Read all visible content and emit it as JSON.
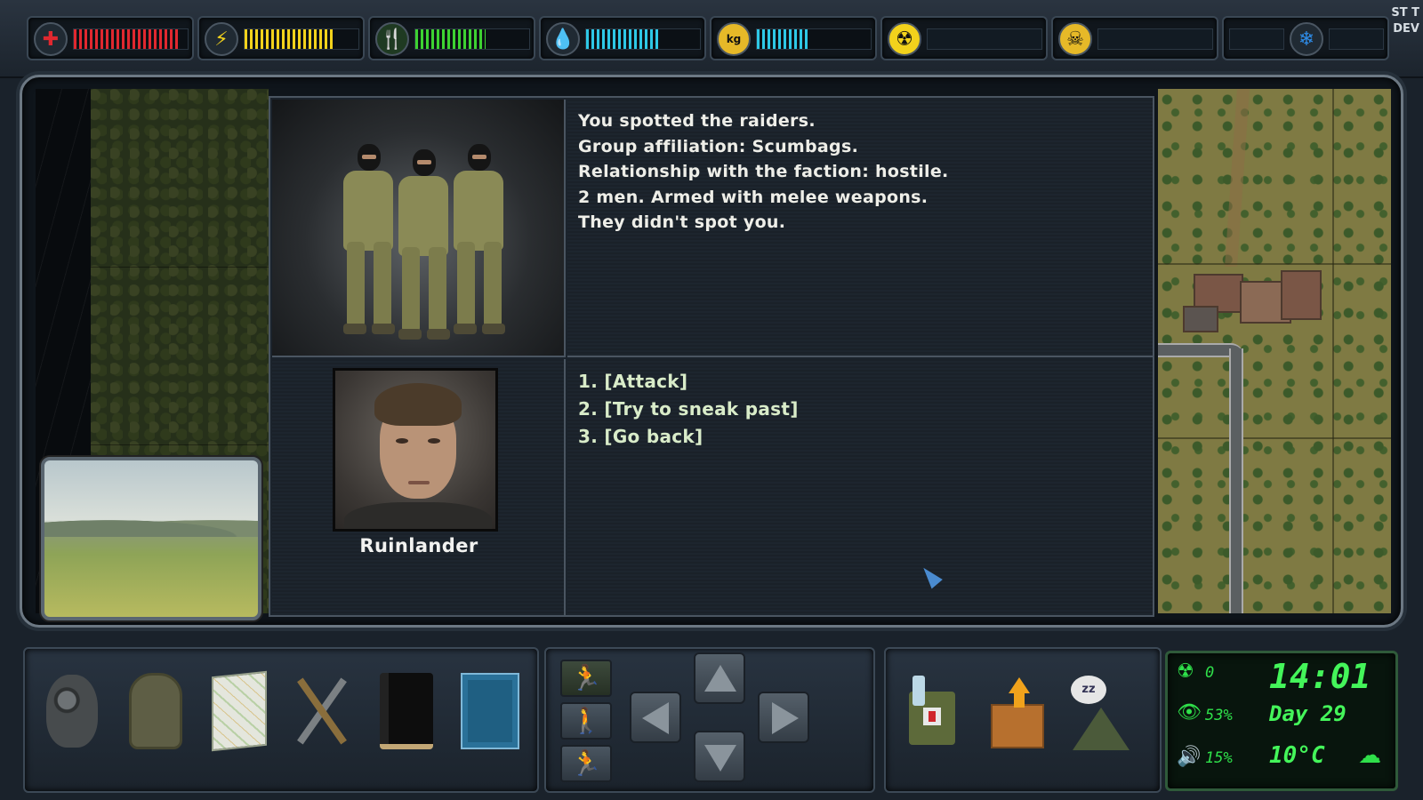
{
  "status_bars": {
    "health": {
      "icon": "health-cross-icon",
      "level": 0.92,
      "color": "#e0282f"
    },
    "energy": {
      "icon": "energy-bolt-icon",
      "level": 0.78,
      "color": "#f2d21c"
    },
    "food": {
      "icon": "food-fork-knife-icon",
      "level": 0.62,
      "color": "#3ed232"
    },
    "water": {
      "icon": "water-drop-icon",
      "level": 0.64,
      "color": "#2ec8e6"
    },
    "weight": {
      "icon": "weight-kg-icon",
      "level": 0.45,
      "color": "#2ec8e6",
      "icon_text": "kg"
    },
    "radiation": {
      "icon": "radiation-icon",
      "level": 0.0,
      "color": "#f2d21c"
    },
    "toxicity": {
      "icon": "skull-toxic-icon",
      "level": 0.0,
      "color": "#f2d21c"
    },
    "cold": {
      "icon": "snowflake-cold-icon",
      "level": 0.0,
      "color": "#2e8be6"
    }
  },
  "corner_label": {
    "line1": "ST T",
    "line2": "DEV"
  },
  "event": {
    "lines": [
      "You spotted the raiders.",
      "Group affiliation: Scumbags.",
      "Relationship with the faction: hostile.",
      "2 men. Armed with melee weapons.",
      "They didn't spot you."
    ]
  },
  "npc": {
    "name": "Ruinlander"
  },
  "choices": [
    "1. [Attack]",
    "2. [Try to sneak past]",
    "3. [Go back]"
  ],
  "toolbar": {
    "gasmask": "gas-mask-icon",
    "backpack": "backpack-icon",
    "map": "map-icon",
    "crafting": "crafting-tools-icon",
    "journal": "journal-book-icon",
    "blueprint": "blueprint-icon"
  },
  "clock": {
    "radiation_value": "0",
    "visibility": "53%",
    "noise": "15%",
    "time": "14:01",
    "day": "Day 29",
    "temperature": "10°C"
  }
}
